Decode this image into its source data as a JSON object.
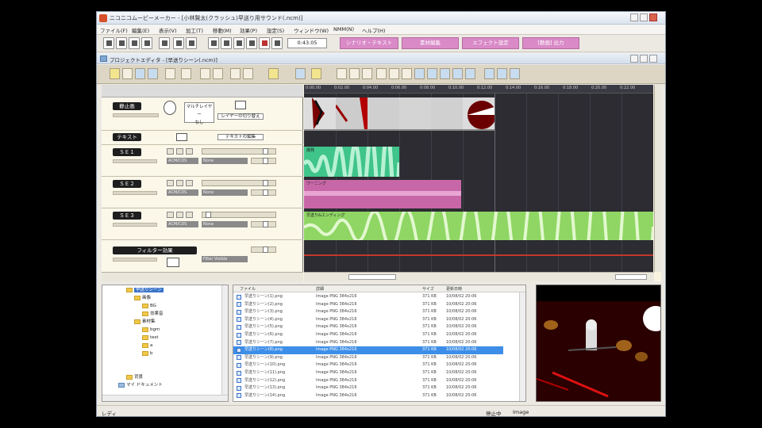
{
  "window": {
    "title": "ニコニコムービーメーカー - [小林賢太(クラッシュ)早送り用サウンド(.ncm)]"
  },
  "menu": [
    "ファイル(F)",
    "編集(E)",
    "表示(V)",
    "加工(T)",
    "移動(M)",
    "効果(P)",
    "設定(S)",
    "ウィンドウ(W)",
    "NMM(N)",
    "ヘルプ(H)"
  ],
  "toolbar": {
    "time": "0:43.05",
    "pink_buttons": [
      "シナリオ・テキスト",
      "素材編集",
      "エフェクト設定",
      "[動画] 出力"
    ]
  },
  "editor": {
    "title": "プロジェクトエディタ - [早送りシーン(.ncm)]",
    "tracks": {
      "video": {
        "label": "静止画",
        "sub": "タイムライン表示",
        "center": "マルチレイヤー",
        "center2": "なし",
        "right_btn": "レイヤーの切り替え"
      },
      "text": {
        "label": "テキスト",
        "right_btn": "テキストの編集"
      },
      "se1": {
        "label": "ＳＥ１",
        "dd1": "ACM/CDS",
        "dd2": "None"
      },
      "se2": {
        "label": "ＳＥ２",
        "dd1": "ACM/CDS",
        "dd2": "None"
      },
      "se3": {
        "label": "ＳＥ３",
        "dd1": "ACM/CDS",
        "dd2": "None"
      },
      "filter": {
        "label": "フィルター効果",
        "btn": "Filter Visible"
      }
    },
    "ruler": [
      "0:00.00",
      "0:02.00",
      "0:04.00",
      "0:06.00",
      "0:08.00",
      "0:10.00",
      "0:12.00",
      "0:14.00",
      "0:16.00",
      "0:18.00",
      "0:20.00",
      "0:22.00"
    ],
    "clips": {
      "se1": "爆発",
      "se2": "ワーニング",
      "se3": "早送り&エンディング"
    }
  },
  "tree": {
    "items": [
      "早送りシーン",
      "画像",
      "BG",
      "効果音",
      "素材集",
      "bgm",
      "test",
      "a",
      "b",
      "背景",
      "マイ ドキュメント"
    ]
  },
  "files": {
    "headers": [
      "ファイル",
      "詳細",
      "サイズ",
      "更新日時"
    ],
    "rows": [
      {
        "name": "早送りシーン(1).png",
        "desc": "Image PNG 384x216",
        "size": "371 KB",
        "date": "10/08/02 20:06"
      },
      {
        "name": "早送りシーン(2).png",
        "desc": "Image PNG 384x216",
        "size": "371 KB",
        "date": "10/08/02 20:06"
      },
      {
        "name": "早送りシーン(3).png",
        "desc": "Image PNG 384x216",
        "size": "371 KB",
        "date": "10/08/02 20:06"
      },
      {
        "name": "早送りシーン(4).png",
        "desc": "Image PNG 384x216",
        "size": "371 KB",
        "date": "10/08/02 20:06"
      },
      {
        "name": "早送りシーン(5).png",
        "desc": "Image PNG 384x216",
        "size": "371 KB",
        "date": "10/08/02 20:06"
      },
      {
        "name": "早送りシーン(6).png",
        "desc": "Image PNG 384x216",
        "size": "371 KB",
        "date": "10/08/02 20:06"
      },
      {
        "name": "早送りシーン(7).png",
        "desc": "Image PNG 384x216",
        "size": "371 KB",
        "date": "10/08/02 20:06"
      },
      {
        "name": "早送りシーン(8).png",
        "desc": "Image PNG 384x216",
        "size": "371 KB",
        "date": "10/08/02 20:06"
      },
      {
        "name": "早送りシーン(9).png",
        "desc": "Image PNG 384x216",
        "size": "371 KB",
        "date": "10/08/02 20:06"
      },
      {
        "name": "早送りシーン(10).png",
        "desc": "Image PNG 384x216",
        "size": "371 KB",
        "date": "10/08/02 20:06"
      },
      {
        "name": "早送りシーン(11).png",
        "desc": "Image PNG 384x216",
        "size": "371 KB",
        "date": "10/08/02 20:06"
      },
      {
        "name": "早送りシーン(12).png",
        "desc": "Image PNG 384x216",
        "size": "371 KB",
        "date": "10/08/02 20:06"
      },
      {
        "name": "早送りシーン(13).png",
        "desc": "Image PNG 384x216",
        "size": "371 KB",
        "date": "10/08/02 20:06"
      },
      {
        "name": "早送りシーン(14).png",
        "desc": "Image PNG 384x216",
        "size": "371 KB",
        "date": "10/08/02 20:06"
      }
    ]
  },
  "status": {
    "left": "レディ",
    "mid": "停止中",
    "right": "Image"
  },
  "colors": {
    "se1_clip": "#3fc48a",
    "se2_clip": "#c867a8",
    "se3_clip": "#8fd664",
    "selection": "#3d8ee8",
    "filter_line": "#c0392b"
  }
}
